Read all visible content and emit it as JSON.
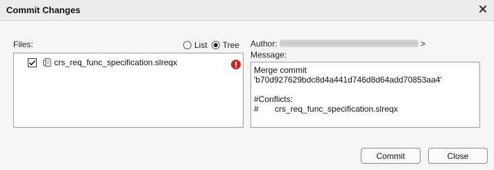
{
  "dialog": {
    "title": "Commit Changes",
    "close_icon": "close-icon"
  },
  "files": {
    "label": "Files:",
    "view_options": [
      {
        "label": "List",
        "selected": false
      },
      {
        "label": "Tree",
        "selected": true
      }
    ],
    "items": [
      {
        "checked": true,
        "icon": "requirements-file-icon",
        "name": "crs_req_func_specification.slreqx",
        "status_icon": "error-icon",
        "status_color": "#c62828"
      }
    ]
  },
  "author": {
    "label": "Author:",
    "value_prefix": "\\",
    "value_suffix": ">"
  },
  "message": {
    "label": "Message:",
    "text": "Merge commit\n'b70d927629bdc8d4a441d746d8d64add70853aa4'\n\n#Conflicts:\n#       crs_req_func_specification.slreqx"
  },
  "buttons": {
    "commit_label": "Commit",
    "close_label": "Close"
  }
}
